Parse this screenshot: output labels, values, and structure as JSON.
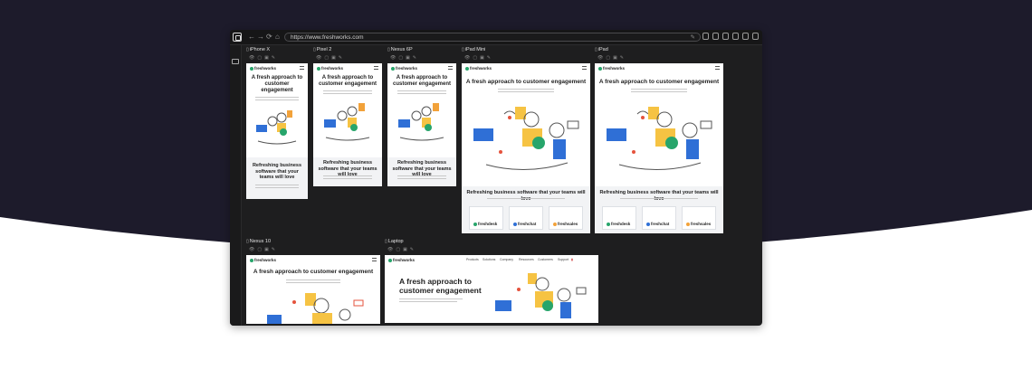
{
  "toolbar": {
    "url": "https://www.freshworks.com",
    "back": "←",
    "forward": "→",
    "reload": "⟳",
    "home": "⌂"
  },
  "devices": {
    "iphone_x": {
      "label": "iPhone X"
    },
    "pixel_2": {
      "label": "Pixel 2"
    },
    "nexus_6p": {
      "label": "Nexus 6P"
    },
    "ipad_mini": {
      "label": "iPad Mini"
    },
    "ipad": {
      "label": "iPad"
    },
    "nexus_10": {
      "label": "Nexus 10"
    },
    "laptop": {
      "label": "Laptop"
    }
  },
  "page": {
    "brand": "freshworks",
    "hero_mobile": "A fresh approach to customer engagement",
    "hero_wide": "A fresh approach to customer engagement",
    "band_mobile": "Refreshing business software that your teams will love",
    "band_tablet": "Refreshing business software that your teams will love",
    "products": [
      "freshdesk",
      "freshchat",
      "freshsales"
    ],
    "laptop_nav": [
      "Products",
      "Solutions",
      "Company",
      "Resources",
      "Customers",
      "Support"
    ]
  },
  "colors": {
    "dark_bg": "#1d1b2b",
    "green": "#27a56b",
    "blue": "#2f6fd6",
    "orange": "#f2a23a",
    "yellow": "#f6c343"
  },
  "icons": {
    "view": "eye-icon",
    "screenshot": "camera-icon",
    "rotate": "rotate-icon",
    "edit": "pen-icon"
  }
}
